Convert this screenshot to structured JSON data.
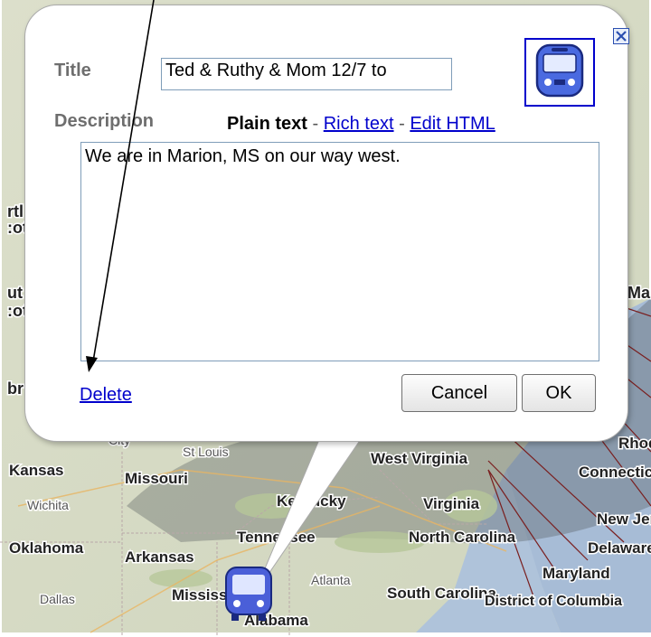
{
  "dialog": {
    "title_label": "Title",
    "title_value": "Ted & Ruthy & Mom 12/7 to",
    "description_label": "Description",
    "mode_plain": "Plain text",
    "mode_rich": "Rich text",
    "mode_html": "Edit HTML",
    "mode_separator": "-",
    "description_value": "We are in Marion, MS on our way west.",
    "delete_label": "Delete",
    "cancel_label": "Cancel",
    "ok_label": "OK",
    "selected_icon": "bus-icon"
  },
  "map": {
    "labels": [
      {
        "text": "Kansas"
      },
      {
        "text": "Missouri"
      },
      {
        "text": "Wichita"
      },
      {
        "text": "St Louis"
      },
      {
        "text": "Oklahoma"
      },
      {
        "text": "Arkansas"
      },
      {
        "text": "Dallas"
      },
      {
        "text": "Tennessee"
      },
      {
        "text": "Kentucky"
      },
      {
        "text": "West Virginia"
      },
      {
        "text": "Virginia"
      },
      {
        "text": "North Carolina"
      },
      {
        "text": "South Carolina"
      },
      {
        "text": "Atlanta"
      },
      {
        "text": "Mississippi"
      },
      {
        "text": "Alabama"
      },
      {
        "text": "Maryland"
      },
      {
        "text": "Delaware"
      },
      {
        "text": "New Jersey"
      },
      {
        "text": "Connecticut"
      },
      {
        "text": "Rhode Island"
      },
      {
        "text": "Maine"
      },
      {
        "text": "District of Columbia"
      },
      {
        "text": "City"
      }
    ],
    "marker_icon": "bus-icon"
  },
  "colors": {
    "link": "#0000cc",
    "label_gray": "#6e6e6e",
    "icon_border": "#0000cc",
    "ocean": "#a3bad6",
    "land": "#d8dbc8"
  }
}
